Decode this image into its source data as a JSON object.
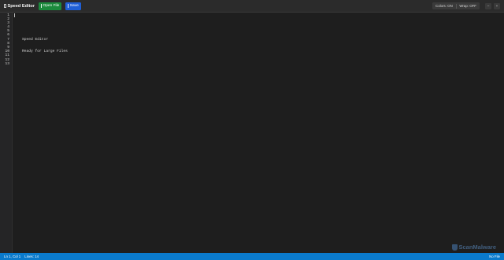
{
  "app": {
    "title": "Speed Editor",
    "icon": "file-icon"
  },
  "toolbar": {
    "open_label": "Open File",
    "save_label": "Save",
    "colors_label": "Colors: ON",
    "wrap_label": "Wrap: OFF",
    "font_decrease_label": "–",
    "font_increase_label": "+"
  },
  "editor": {
    "line_numbers": [
      "1",
      "2",
      "3",
      "4",
      "5",
      "6",
      "7",
      "8",
      "9",
      "10",
      "11",
      "12",
      "13"
    ],
    "lines": [
      "",
      "",
      "",
      "",
      "",
      "",
      "Speed Editor",
      "",
      "",
      "Ready for Large Files",
      "",
      "",
      ""
    ]
  },
  "watermark": {
    "text": "ScanMalware"
  },
  "status": {
    "position": "Ln 1, Col 1",
    "lines": "Lines: 14",
    "file": "No File"
  },
  "colors": {
    "toolbar_bg": "#2b2b2b",
    "editor_bg": "#1e1e1e",
    "open_button": "#1b8a3c",
    "save_button": "#1f5fd6",
    "statusbar": "#0a7acc"
  }
}
